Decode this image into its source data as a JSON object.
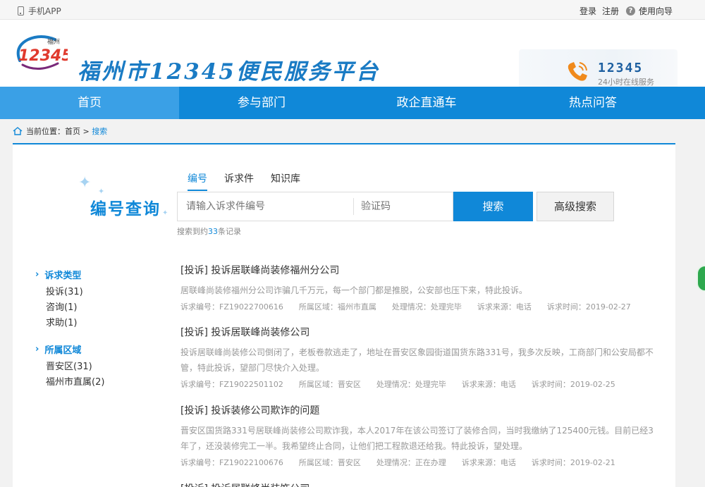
{
  "topbar": {
    "app_label": "手机APP",
    "login": "登录",
    "register": "注册",
    "help_icon": "?",
    "guide": "使用向导"
  },
  "header": {
    "logo_text": "12345",
    "logo_sub": "福州",
    "site_title": "福州市12345便民服务平台",
    "hotline_number": "12345",
    "hotline_sub": "24小时在线服务"
  },
  "nav": [
    {
      "label": "首页",
      "active": true
    },
    {
      "label": "参与部门",
      "active": false
    },
    {
      "label": "政企直通车",
      "active": false
    },
    {
      "label": "热点问答",
      "active": false
    }
  ],
  "breadcrumb": {
    "prefix": "当前位置：",
    "home": "首页",
    "sep": " > ",
    "current": "搜索"
  },
  "search": {
    "heading": "编号查询",
    "tabs": [
      "编号",
      "诉求件",
      "知识库"
    ],
    "active_tab": "编号",
    "query_placeholder": "请输入诉求件编号",
    "code_placeholder": "验证码",
    "search_button": "搜索",
    "advanced_button": "高级搜索",
    "result_prefix": "搜索到约",
    "result_count": "33",
    "result_suffix": "条记录"
  },
  "facets": [
    {
      "heading": "诉求类型",
      "options": [
        "投诉(31)",
        "咨询(1)",
        "求助(1)"
      ]
    },
    {
      "heading": "所属区域",
      "options": [
        "晋安区(31)",
        "福州市直属(2)"
      ]
    }
  ],
  "results": [
    {
      "title": "[投诉] 投诉居联峰尚装修福州分公司",
      "desc": "居联峰尚装修福州分公司诈骗几千万元，每一个部门都是推脱，公安部也压下来，特此投诉。",
      "meta": [
        "诉求编号：FZ19022700616",
        "所属区域：福州市直属",
        "处理情况：处理完毕",
        "诉求来源：电话",
        "诉求时间：2019-02-27"
      ]
    },
    {
      "title": "[投诉] 投诉居联峰尚装修公司",
      "desc": "投诉居联峰尚装修公司倒闭了，老板卷款逃走了，地址在晋安区象园街道国货东路331号，我多次反映，工商部门和公安局都不管，特此投诉，望部门尽快介入处理。",
      "meta": [
        "诉求编号：FZ19022501102",
        "所属区域：晋安区",
        "处理情况：处理完毕",
        "诉求来源：电话",
        "诉求时间：2019-02-25"
      ]
    },
    {
      "title": "[投诉] 投诉装修公司欺诈的问题",
      "desc": "晋安区国货路331号居联峰尚装修公司欺诈我，本人2017年在该公司签订了装修合同，当时我缴纳了125400元钱。目前已经3年了，还没装修完工一半。我希望终止合同，让他们把工程款退还给我。特此投诉，望处理。",
      "meta": [
        "诉求编号：FZ19022100676",
        "所属区域：晋安区",
        "处理情况：正在办理",
        "诉求来源：电话",
        "诉求时间：2019-02-21"
      ]
    },
    {
      "title": "[投诉] 投诉居联峰尚装饰公司",
      "desc": "",
      "meta": []
    }
  ],
  "colors": {
    "primary": "#1088d8",
    "nav_active": "#3aa0e6",
    "title": "#1a7bc4",
    "badge": "#2ea84e"
  }
}
